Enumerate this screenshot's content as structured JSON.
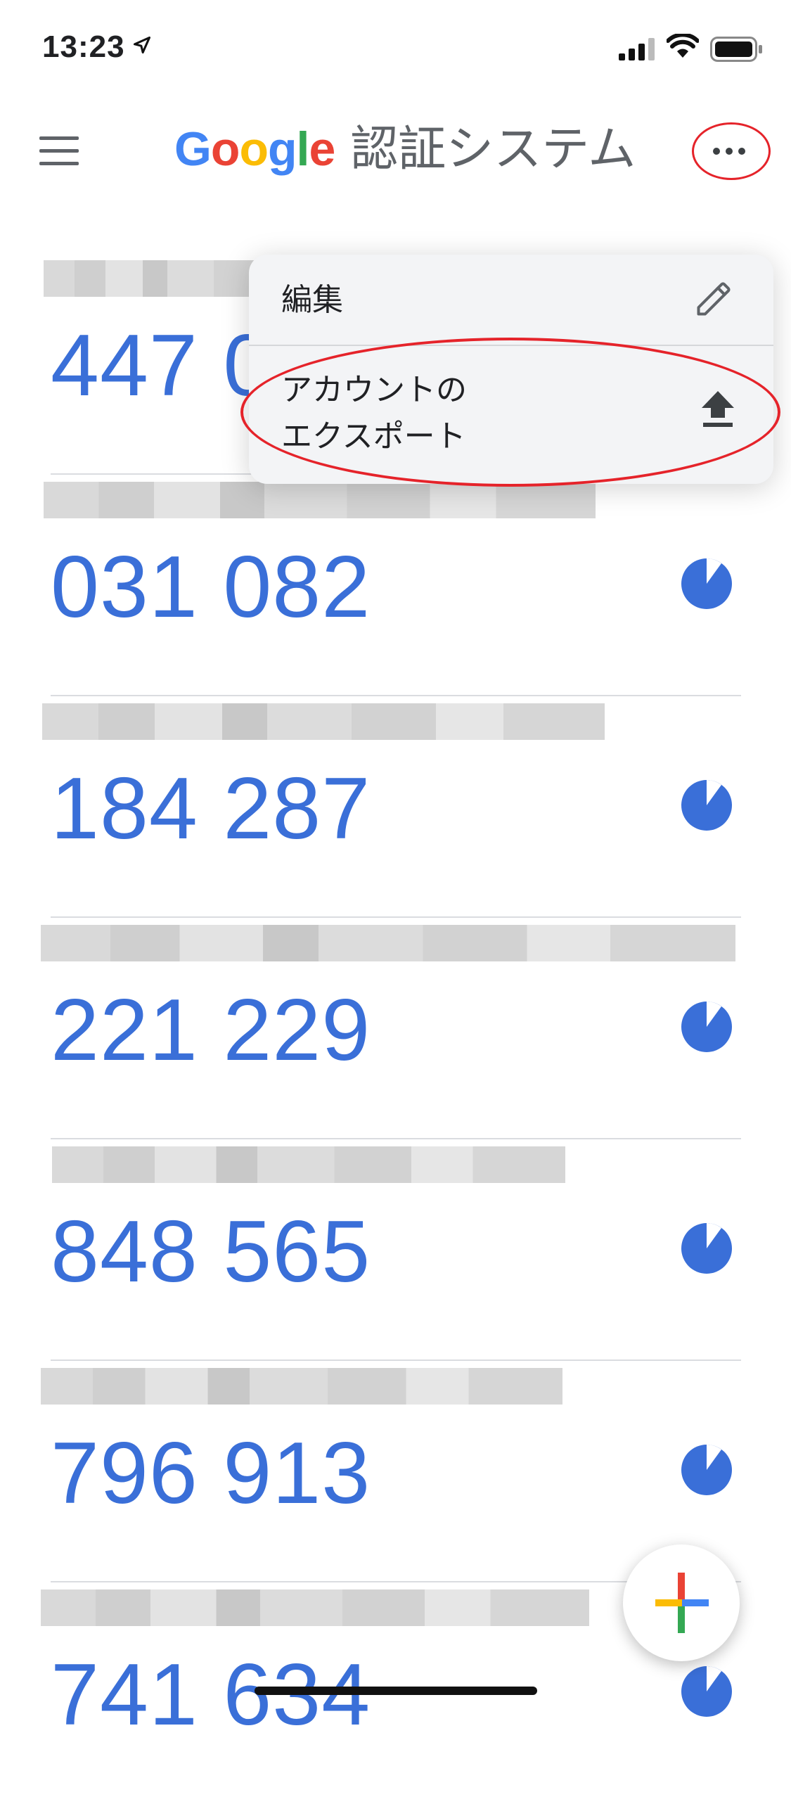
{
  "status_bar": {
    "time": "13:23"
  },
  "app_bar": {
    "brand_letters": [
      "G",
      "o",
      "o",
      "g",
      "l",
      "e"
    ],
    "subtitle": "認証システム"
  },
  "accounts": [
    {
      "code": "447 0"
    },
    {
      "code": "031 082"
    },
    {
      "code": "184 287"
    },
    {
      "code": "221 229"
    },
    {
      "code": "848 565"
    },
    {
      "code": "796 913"
    },
    {
      "code": "741 634"
    }
  ],
  "menu": {
    "edit_label": "編集",
    "export_label_line1": "アカウントの",
    "export_label_line2": "エクスポート"
  },
  "colors": {
    "accent": "#3a6fd8",
    "highlight_ring": "#e5232a"
  }
}
